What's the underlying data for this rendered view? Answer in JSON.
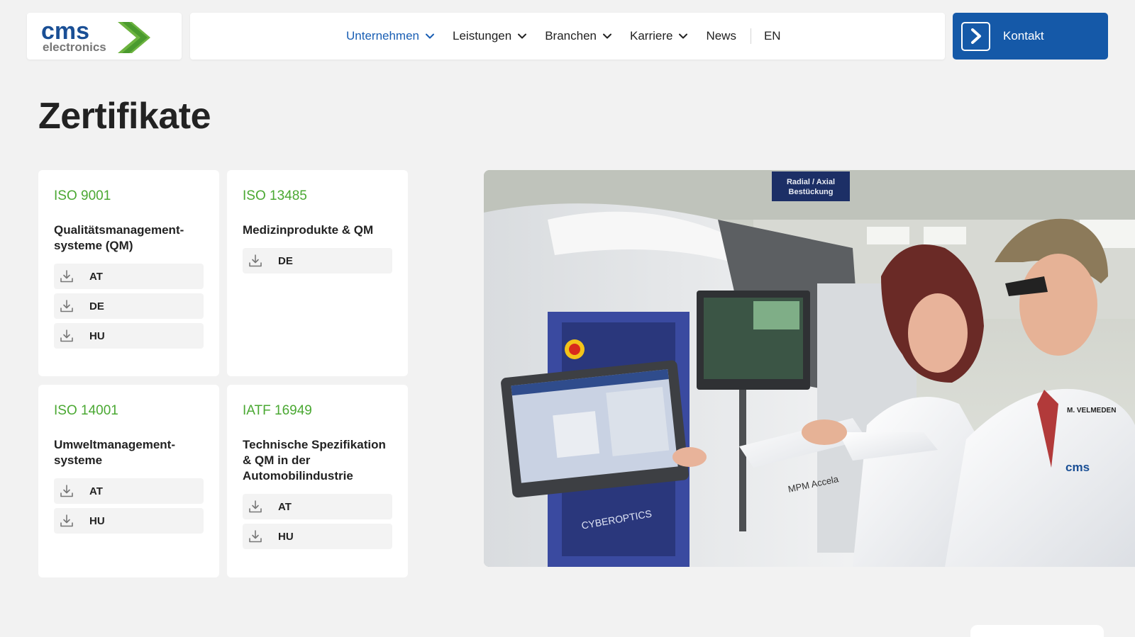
{
  "logo": {
    "text_top": "cms",
    "text_bottom": "electronics"
  },
  "nav": {
    "items": [
      {
        "label": "Unternehmen",
        "active": true,
        "has_dropdown": true
      },
      {
        "label": "Leistungen",
        "active": false,
        "has_dropdown": true
      },
      {
        "label": "Branchen",
        "active": false,
        "has_dropdown": true
      },
      {
        "label": "Karriere",
        "active": false,
        "has_dropdown": true
      },
      {
        "label": "News",
        "active": false,
        "has_dropdown": false
      }
    ],
    "language": "EN"
  },
  "contact_button": {
    "label": "Kontakt"
  },
  "page_title": "Zertifikate",
  "certificates": [
    {
      "code": "ISO 9001",
      "description": "Qualitätsmanagement-\nsysteme (QM)",
      "downloads": [
        "AT",
        "DE",
        "HU"
      ]
    },
    {
      "code": "ISO 13485",
      "description": "Medizinprodukte & QM",
      "downloads": [
        "DE"
      ]
    },
    {
      "code": "ISO 14001",
      "description": "Umweltmanagement-\nsysteme",
      "downloads": [
        "AT",
        "HU"
      ]
    },
    {
      "code": "IATF 16949",
      "description": "Technische Spezifikation\n& QM in der\nAutomobilindustrie",
      "downloads": [
        "AT",
        "HU"
      ]
    }
  ],
  "photo": {
    "sign_text": [
      "Radial / Axial",
      "Bestückung"
    ],
    "machine_brand": "CYBEROPTICS",
    "machine_model": "MPM Accela",
    "name_badge": "M. VELMEDEN",
    "coat_logo": "cms"
  },
  "colors": {
    "accent_blue": "#1559a8",
    "active_nav": "#1a5fb4",
    "cert_green": "#4aa832",
    "background": "#f2f2f2"
  },
  "icons": {
    "download": "download-icon",
    "chevron": "chevron-down-icon",
    "arrow": "arrow-right-icon"
  }
}
